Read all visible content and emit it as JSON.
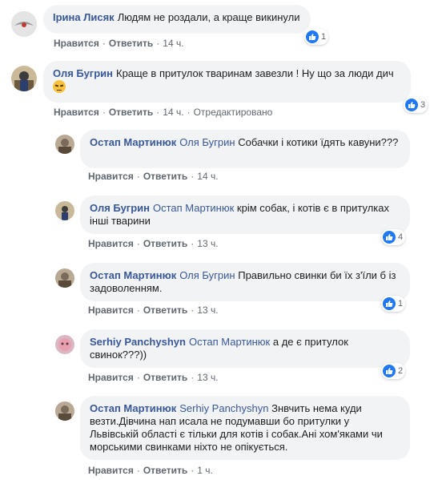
{
  "ui": {
    "like": "Нравится",
    "reply": "Ответить",
    "dot": "·"
  },
  "comments": [
    {
      "author": "Ірина Лисяк",
      "text": "Людям не роздали, а краще викинули",
      "time": "14 ч.",
      "edited": "",
      "reactions": "1"
    },
    {
      "author": "Оля Бугрин",
      "text": "Краще в притулок тваринам завезли ! Ну що за люди дич",
      "emoji": "pensive-face",
      "time": "14 ч.",
      "edited": "Отредактировано",
      "reactions": "3"
    },
    {
      "author": "Остап Мартинюк",
      "mention": "Оля Бугрин",
      "text": "Собачки і котики їдять кавуни???",
      "time": "14 ч.",
      "reactions": ""
    },
    {
      "author": "Оля Бугрин",
      "mention": "Остап Мартинюк",
      "text": "крім собак, і котів є в притулках інші тварини",
      "time": "13 ч.",
      "reactions": "4"
    },
    {
      "author": "Остап Мартинюк",
      "mention": "Оля Бугрин",
      "text": "Правильно свинки би їх з'їли б із задоволенням.",
      "time": "13 ч.",
      "reactions": "1"
    },
    {
      "author": "Serhiy Panchyshyn",
      "mention": "Остап Мартинюк",
      "text": "а де є притулок свинок???))",
      "time": "13 ч.",
      "reactions": "2"
    },
    {
      "author": "Остап Мартинюк",
      "mention": "Serhiy Panchyshyn",
      "text": "Знвчить нема куди везти.Дівчина нап исала не подумавши бо притулки у Львівській області є тільки для котів і собак.Ані хом'яками чи морськими свинками ніхто не опікується.",
      "time": "1 ч.",
      "reactions": ""
    }
  ]
}
